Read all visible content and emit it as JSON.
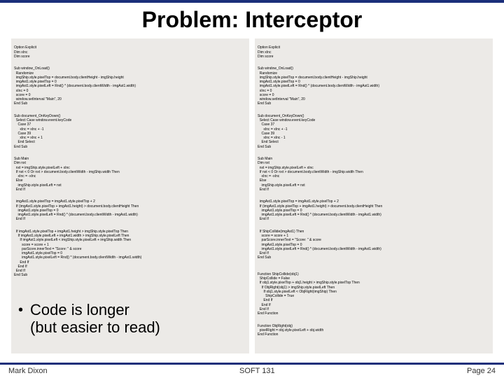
{
  "title": "Problem: Interceptor",
  "code_left": {
    "header": "Option Explicit\nDim xInc\nDim score",
    "onload": "Sub window_OnLoad()\n  Randomize\n  imgShip.style.pixelTop = document.body.clientHeight - imgShip.height\n  imgAst1.style.pixelTop = 0\n  imgAst1.style.pixelLeft = Rnd() * (document.body.clientWidth - imgAst1.width)\n  xInc = 0\n  score = 0\n  window.setInterval \"Main\", 20\nEnd Sub",
    "onkey": "Sub document_OnKeyDown()\n  Select Case window.event.keyCode\n    Case 37\n      xInc = xInc + -1\n    Case 39\n      xInc = xInc + 1\n    End Select\nEnd Sub",
    "main1": "Sub Main\nDim nxt\n  nxt = imgShip.style.pixelLeft + xInc\n  If nxt < 0 Or nxt > document.body.clientWidth - imgShip.width Then\n    xInc = -xInc\n  Else\n    imgShip.style.pixelLeft = nxt\n  End If",
    "main2": "  imgAst1.style.pixelTop = imgAst1.style.pixelTop + 2\n  If (imgAst1.style.pixelTop + imgAst1.height) > document.body.clientHeight Then\n    imgAst1.style.pixelTop = 0\n    imgAst1.style.pixelLeft = Rnd() * (document.body.clientWidth - imgAst1.width)\n  End If",
    "main3": "  If imgAst1.style.pixelTop + imgAst1.height > imgShip.style.pixelTop Then\n    If imgAst1.style.pixelLeft + imgAst1.width > imgShip.style.pixelLeft Then\n      If imgAst1.style.pixelLeft < imgShip.style.pixelLeft + imgShip.width Then\n        score = score + 1\n        parScore.innerText = \"Score: \" & score\n        imgAst1.style.pixelTop = 0\n        imgAst1.style.pixelLeft = Rnd() * (document.body.clientWidth - imgAst1.width)\n      End If\n    End If\n  End If\nEnd Sub"
  },
  "code_right": {
    "header": "Option Explicit\nDim xInc\nDim score",
    "onload": "Sub window_OnLoad()\n  Randomize\n  imgShip.style.pixelTop = document.body.clientHeight - imgShip.height\n  imgAst1.style.pixelTop = 0\n  imgAst1.style.pixelLeft = Rnd() * (document.body.clientWidth - imgAst1.width)\n  xInc = 0\n  score = 0\n  window.setInterval \"Main\", 20\nEnd Sub",
    "onkey": "Sub document_OnKeyDown()\n  Select Case window.event.keyCode\n    Case 37\n      xInc = xInc + -1\n    Case 39\n      xInc = xInc - 1\n    End Select\nEnd Sub",
    "main1": "Sub Main\nDim nxt\n  nxt = imgShip.style.pixelLeft + xInc\n  If nxt < 0 Or nxt > document.body.clientWidth - imgShip.width Then\n    xInc = -xInc\n  Else\n    imgShip.style.pixelLeft = nxt\n  End If",
    "main2": "  imgAst1.style.pixelTop = imgAst1.style.pixelTop + 2\n  If (imgAst1.style.pixelTop + imgAst1.height) > document.body.clientHeight Then\n    imgAst1.style.pixelTop = 0\n    imgAst1.style.pixelLeft = Rnd() * (document.body.clientWidth - imgAst1.width)\n  End If",
    "main3": "  If ShipCollide(imgAst1) Then\n    score = score + 1\n    parScore.innerText = \"Score: \" & score\n    imgAst1.style.pixelTop = 0\n    imgAst1.style.pixelLeft = Rnd() * (document.body.clientWidth - imgAst1.width)\n  End If\nEnd Sub",
    "fn1": "Function ShipCollide(obj1)\n  ShipCollide = False\n  If obj1.style.pixelTop + obj1.height > imgShip.style.pixelTop Then\n    If ObjRight(obj1) > imgShip.style.pixelLeft Then\n      If obj1.style.pixelLeft < ObjRight(imgShip) Then\n        ShipCollide = True\n      End If\n    End If\n  End If\nEnd Function",
    "fn2": "Function ObjRight(obj)\n  pixelRight = obj.style.pixelLeft + obj.width\nEnd Function"
  },
  "bullet": {
    "line1": "Code is longer",
    "line2": "(but easier to read)"
  },
  "footer": {
    "left": "Mark Dixon",
    "center": "SOFT 131",
    "right": "Page 24"
  }
}
